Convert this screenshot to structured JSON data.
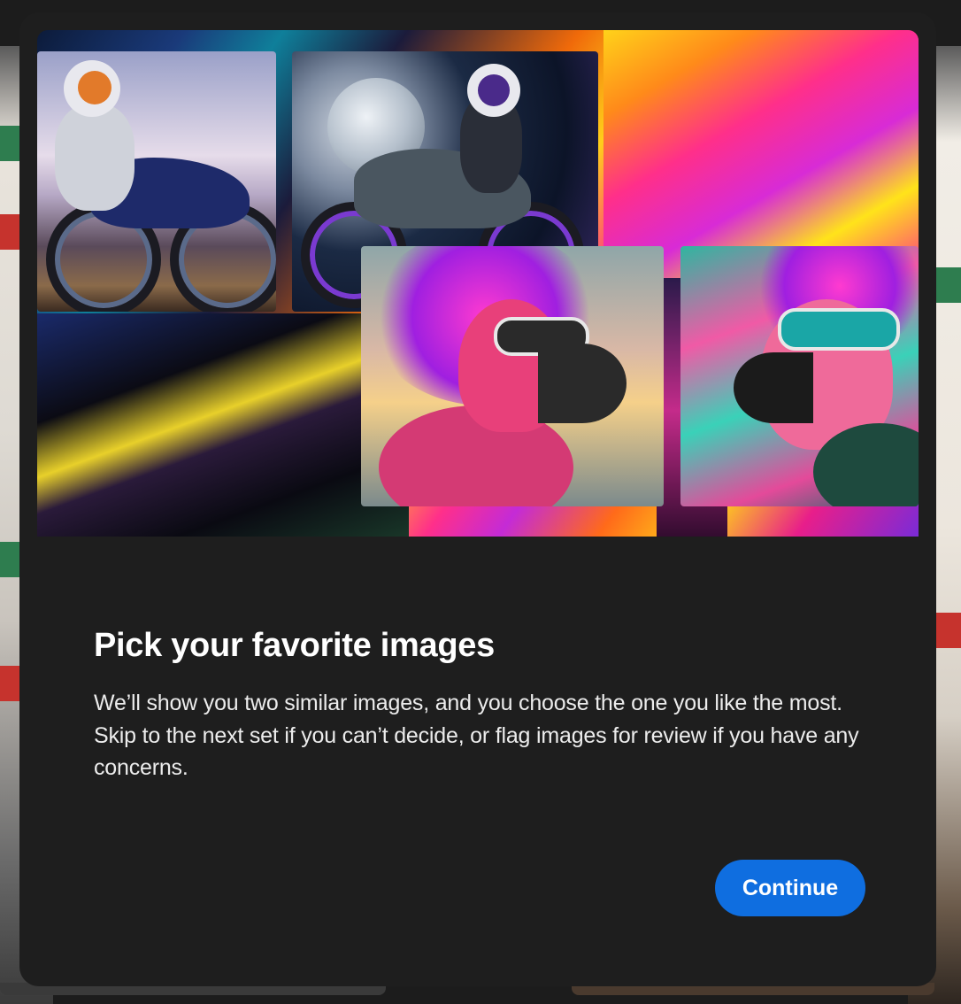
{
  "dialog": {
    "title": "Pick your favorite images",
    "description": "We’ll show you two similar images, and you choose the one you like the most. Skip to the next set if you can’t decide, or flag images for review if you have any concerns.",
    "continue_label": "Continue"
  },
  "hero": {
    "images": [
      {
        "subject": "astronaut riding motorcycle at sunset"
      },
      {
        "subject": "astronaut riding motorcycle in front of moon"
      },
      {
        "subject": "punk flamingo with goggles"
      },
      {
        "subject": "neon flamingo with sunglasses"
      }
    ]
  },
  "colors": {
    "modal_bg": "#1e1e1e",
    "accent": "#0f6ee0",
    "text": "#ffffff"
  }
}
